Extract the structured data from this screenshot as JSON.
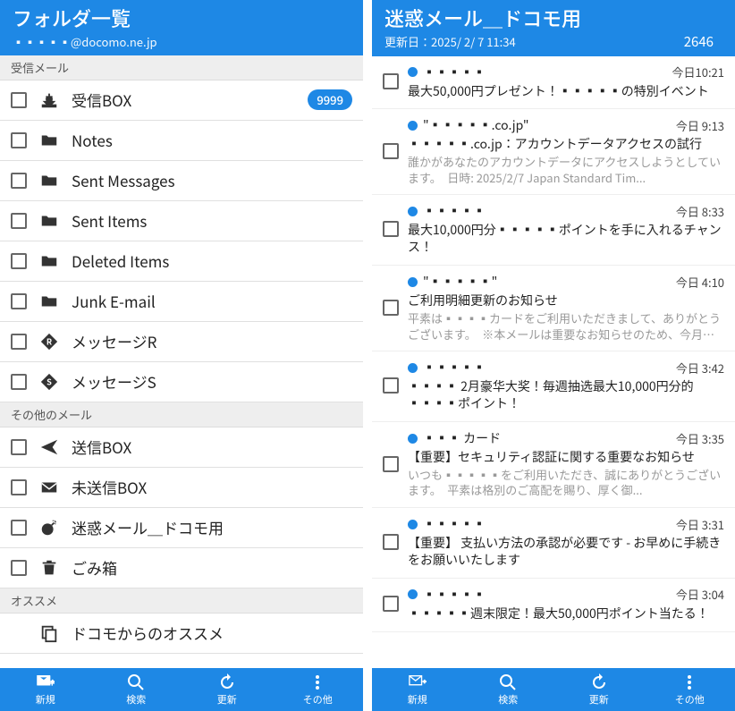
{
  "left": {
    "title": "フォルダ一覧",
    "account": "▪▪▪▪▪@docomo.ne.jp",
    "sections": [
      {
        "label": "受信メール",
        "folders": [
          {
            "icon": "inbox",
            "label": "受信BOX",
            "badge": "9999"
          },
          {
            "icon": "folder",
            "label": "Notes"
          },
          {
            "icon": "folder",
            "label": "Sent Messages"
          },
          {
            "icon": "folder",
            "label": "Sent Items"
          },
          {
            "icon": "folder",
            "label": "Deleted Items"
          },
          {
            "icon": "folder",
            "label": "Junk E-mail"
          },
          {
            "icon": "diamond-r",
            "label": "メッセージR"
          },
          {
            "icon": "diamond-s",
            "label": "メッセージS"
          }
        ]
      },
      {
        "label": "その他のメール",
        "folders": [
          {
            "icon": "send",
            "label": "送信BOX"
          },
          {
            "icon": "draft",
            "label": "未送信BOX"
          },
          {
            "icon": "bomb",
            "label": "迷惑メール＿ドコモ用"
          },
          {
            "icon": "trash",
            "label": "ごみ箱"
          }
        ]
      },
      {
        "label": "オススメ",
        "folders": [
          {
            "icon": "copy",
            "label": "ドコモからのオススメ",
            "noCheck": true
          }
        ]
      }
    ]
  },
  "right": {
    "title": "迷惑メール＿ドコモ用",
    "updated": "更新日：2025/ 2/ 7 11:34",
    "count": "2646",
    "mails": [
      {
        "sender": "▪▪▪▪▪",
        "time": "今日10:21",
        "subject": "最大50,000円プレゼント！▪▪▪▪▪の特別イベント",
        "preview": ""
      },
      {
        "sender": "\"▪▪▪▪▪.co.jp\"",
        "time": "今日 9:13",
        "subject": "▪▪▪▪▪.co.jp：アカウントデータアクセスの試行",
        "preview": "誰かがあなたのアカウントデータにアクセスしようとしています。　日時: 2025/2/7 Japan Standard Tim..."
      },
      {
        "sender": "▪▪▪▪▪",
        "time": "今日 8:33",
        "subject": "最大10,000円分▪▪▪▪▪ポイントを手に入れるチャンス！",
        "preview": ""
      },
      {
        "sender": "\"▪▪▪▪▪\"",
        "time": "今日 4:10",
        "subject": "ご利用明細更新のお知らせ",
        "preview": "平素は▪▪▪▪カードをご利用いただきまして、ありがとうございます。　※本メールは重要なお知らせのため、今月のお支払予定が..."
      },
      {
        "sender": "▪▪▪▪▪",
        "time": "今日 3:42",
        "subject": "▪▪▪▪ 2月豪华大奖！毎週抽选最大10,000円分的▪▪▪▪ポイント！",
        "preview": ""
      },
      {
        "sender": "▪▪▪ カード",
        "time": "今日 3:35",
        "subject": "【重要】セキュリティ認証に関する重要なお知らせ",
        "preview": "いつも▪▪▪▪▪をご利用いただき、誠にありがとうございます。　平素は格別のご高配を賜り、厚く御..."
      },
      {
        "sender": "▪▪▪▪▪",
        "time": "今日 3:31",
        "subject": "【重要】 支払い方法の承認が必要です - お早めに手続きをお願いいたします",
        "preview": ""
      },
      {
        "sender": "▪▪▪▪▪",
        "time": "今日 3:04",
        "subject": "▪▪▪▪▪週末限定！最大50,000円ポイント当たる！",
        "preview": ""
      }
    ]
  },
  "bottom": {
    "new": "新規",
    "search": "検索",
    "refresh": "更新",
    "other": "その他"
  }
}
